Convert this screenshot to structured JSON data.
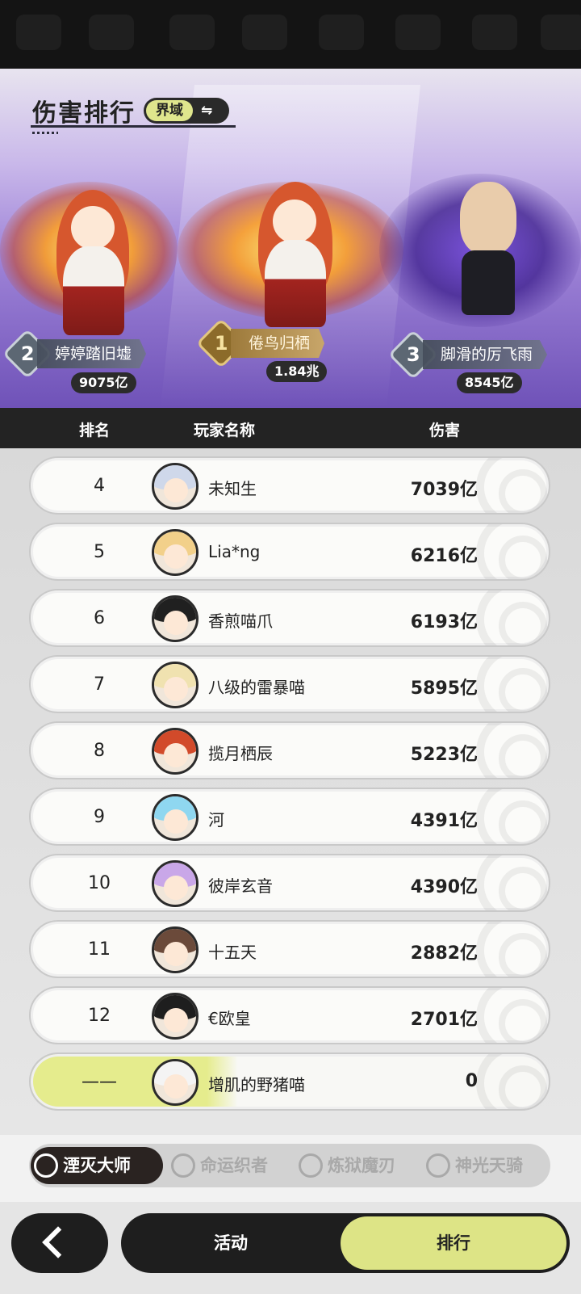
{
  "header": {
    "title": "伤害排行",
    "realm_label": "界域",
    "swap_icon": "⇋"
  },
  "podium": [
    {
      "rank": "2",
      "name": "婷婷踏旧墟",
      "score": "9075亿"
    },
    {
      "rank": "1",
      "name": "倦鸟归栖",
      "score": "1.84兆"
    },
    {
      "rank": "3",
      "name": "脚滑的厉飞雨",
      "score": "8545亿"
    }
  ],
  "table_header": {
    "rank": "排名",
    "player": "玩家名称",
    "damage": "伤害"
  },
  "rows": [
    {
      "rank": "4",
      "name": "未知生",
      "damage": "7039亿",
      "hair": "#cfd8ea"
    },
    {
      "rank": "5",
      "name": "Lia*ng",
      "damage": "6216亿",
      "hair": "#f2d08a"
    },
    {
      "rank": "6",
      "name": "香煎喵爪",
      "damage": "6193亿",
      "hair": "#202020"
    },
    {
      "rank": "7",
      "name": "八级的雷暴喵",
      "damage": "5895亿",
      "hair": "#f0e2b0"
    },
    {
      "rank": "8",
      "name": "揽月栖辰",
      "damage": "5223亿",
      "hair": "#d24a2a"
    },
    {
      "rank": "9",
      "name": "河",
      "damage": "4391亿",
      "hair": "#8fd7f0"
    },
    {
      "rank": "10",
      "name": "彼岸玄音",
      "damage": "4390亿",
      "hair": "#c9a7e8"
    },
    {
      "rank": "11",
      "name": "十五天",
      "damage": "2882亿",
      "hair": "#6b4a3a"
    },
    {
      "rank": "12",
      "name": "€欧皇",
      "damage": "2701亿",
      "hair": "#1e1e1e"
    }
  ],
  "self_row": {
    "rank": "——",
    "name": "增肌的野猪喵",
    "damage": "0",
    "hair": "#f4f4f4"
  },
  "class_tabs": [
    "湮灭大师",
    "命运织者",
    "炼狱魔刃",
    "神光天骑"
  ],
  "bottom_nav": {
    "activity": "活动",
    "ranking": "排行"
  }
}
